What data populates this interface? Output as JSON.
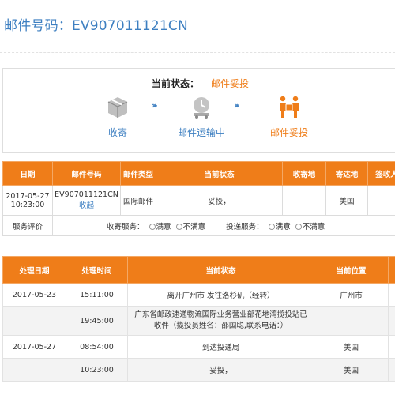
{
  "header": {
    "title": "邮件号码：EV907011121CN"
  },
  "status": {
    "label": "当前状态：",
    "value": "邮件妥投",
    "steps": [
      {
        "label": "收寄",
        "icon": "package-icon"
      },
      {
        "label": "邮件运输中",
        "icon": "transport-icon"
      },
      {
        "label": "邮件妥投",
        "icon": "delivery-people-icon"
      }
    ],
    "arrows": "›››"
  },
  "mail_table": {
    "headers": [
      "日期",
      "邮件号码",
      "邮件类型",
      "当前状态",
      "收寄地",
      "寄达地",
      "签收人"
    ],
    "row": {
      "date": "2017-05-27 10:23:00",
      "number": "EV907011121CN",
      "collapse_link": "收起",
      "type": "国际邮件",
      "status": "妥投，",
      "origin": "",
      "destination": "美国",
      "signer": ""
    },
    "rating": {
      "label": "服务评价",
      "collect_label": "收寄服务：",
      "deliver_label": "投递服务：",
      "satisfied": "满意",
      "unsatisfied": "不满意"
    }
  },
  "tracking_table": {
    "headers": [
      "处理日期",
      "处理时间",
      "当前状态",
      "当前位置"
    ],
    "rows": [
      {
        "date": "2017-05-23",
        "time": "15:11:00",
        "status": "离开广州市 发往洛杉矶（经转）",
        "location": "广州市"
      },
      {
        "date": "",
        "time": "19:45:00",
        "status": "广东省邮政速递物流国际业务营业部花地湾揽投站已收件（揽投员姓名：邵国聪,联系电话：）",
        "location": ""
      },
      {
        "date": "2017-05-27",
        "time": "08:54:00",
        "status": "到达投递局",
        "location": "美国"
      },
      {
        "date": "",
        "time": "10:23:00",
        "status": "妥投，",
        "location": "美国"
      }
    ]
  },
  "colors": {
    "accent": "#ef7d19",
    "link": "#3d7fc1"
  }
}
